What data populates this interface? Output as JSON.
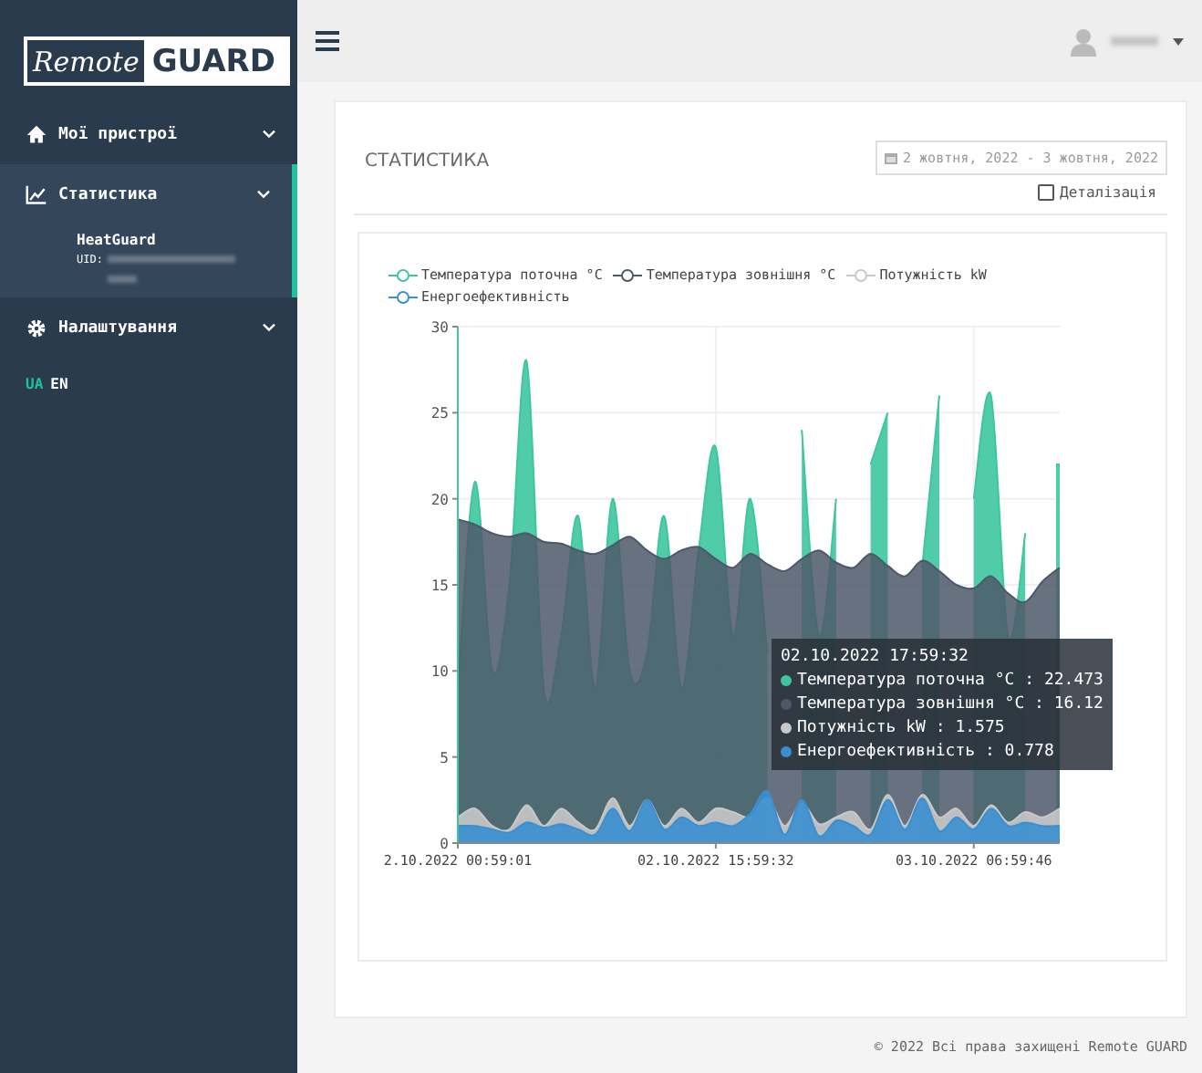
{
  "sidebar": {
    "logo": {
      "script": "Remote",
      "bold": "GUARD"
    },
    "items": [
      {
        "label": "Мої пристрої",
        "selected": false
      },
      {
        "label": "Статистика",
        "selected": true,
        "children": [
          {
            "label": "HeatGuard",
            "uid_label": "UID:"
          }
        ]
      },
      {
        "label": "Налаштування",
        "selected": false
      }
    ],
    "languages": [
      {
        "label": "UA",
        "selected": true
      },
      {
        "label": "EN",
        "selected": false
      }
    ]
  },
  "card": {
    "title": "СТАТИСТИКА",
    "date_range": "2 жовтня, 2022 - 3 жовтня, 2022",
    "detail_checkbox": {
      "label": "Деталізація",
      "checked": false
    },
    "chart_data": {
      "type": "area",
      "categories": [
        "2.10.2022 00:59:01",
        null,
        null,
        null,
        null,
        null,
        null,
        null,
        null,
        null,
        null,
        null,
        null,
        null,
        null,
        "02.10.2022 15:59:32",
        null,
        null,
        null,
        null,
        null,
        null,
        null,
        null,
        null,
        null,
        null,
        null,
        null,
        null,
        "03.10.2022 06:59:46",
        null,
        null,
        null,
        null,
        null
      ],
      "ylim": [
        0,
        30
      ],
      "grid": true,
      "yticks": [
        0,
        5,
        10,
        15,
        20,
        25,
        30
      ],
      "series": [
        {
          "name": "Температура поточна °C",
          "color": "#3ec6a0",
          "values": [
            9,
            21,
            10,
            15,
            28,
            9,
            12,
            19,
            9,
            20,
            10,
            11,
            19,
            9,
            17,
            23,
            12,
            20,
            11,
            null,
            24,
            12,
            20,
            null,
            22,
            25,
            null,
            16,
            26,
            null,
            20,
            26,
            12,
            18,
            null,
            22
          ]
        },
        {
          "name": "Температура зовнішня °C",
          "color": "#4d5868",
          "values": [
            18.8,
            18.5,
            18,
            17.8,
            18,
            17.5,
            17.4,
            17,
            16.8,
            17.3,
            17.8,
            17,
            16.5,
            17,
            17.2,
            16.5,
            16,
            16.8,
            16.2,
            15.8,
            16.5,
            17,
            16.3,
            16,
            16.8,
            16.1,
            15.5,
            16.4,
            15.8,
            15,
            14.8,
            15.5,
            14.5,
            14,
            15.2,
            16
          ]
        },
        {
          "name": "Потужність kW",
          "color": "#c8c8c8",
          "values": [
            1.5,
            2,
            1,
            0.8,
            2.2,
            1,
            2,
            1.2,
            0.8,
            2.6,
            1,
            2.5,
            1,
            2,
            1.2,
            2,
            1.8,
            1.5,
            2.6,
            1,
            2.3,
            1.1,
            1.5,
            1.8,
            0.8,
            2.8,
            1,
            2.8,
            1.5,
            2,
            1,
            2.2,
            1.2,
            1.8,
            1.5,
            2
          ]
        },
        {
          "name": "Енергоефективність",
          "color": "#3a8fd0",
          "values": [
            1,
            1,
            0.8,
            0.6,
            1.2,
            0.9,
            1.1,
            0.8,
            0.5,
            2,
            0.7,
            2.5,
            0.8,
            1.5,
            1,
            1.2,
            1,
            1.7,
            3,
            0.5,
            2.5,
            0.4,
            1.3,
            1,
            0.5,
            2.5,
            0.8,
            2.6,
            0.7,
            1.5,
            0.8,
            2,
            1,
            1.2,
            1,
            1
          ]
        }
      ]
    },
    "tooltip": {
      "title": "02.10.2022 17:59:32",
      "rows": [
        {
          "text": "Температура поточна °C : 22.473",
          "color": "#3ec6a0"
        },
        {
          "text": "Температура зовнішня °C : 16.12",
          "color": "#4d5868"
        },
        {
          "text": "Потужність kW : 1.575",
          "color": "#c8c8c8"
        },
        {
          "text": "Енергоефективність : 0.778",
          "color": "#3a8fd0"
        }
      ]
    }
  },
  "footer": "© 2022 Всі права захищені Remote GUARD"
}
